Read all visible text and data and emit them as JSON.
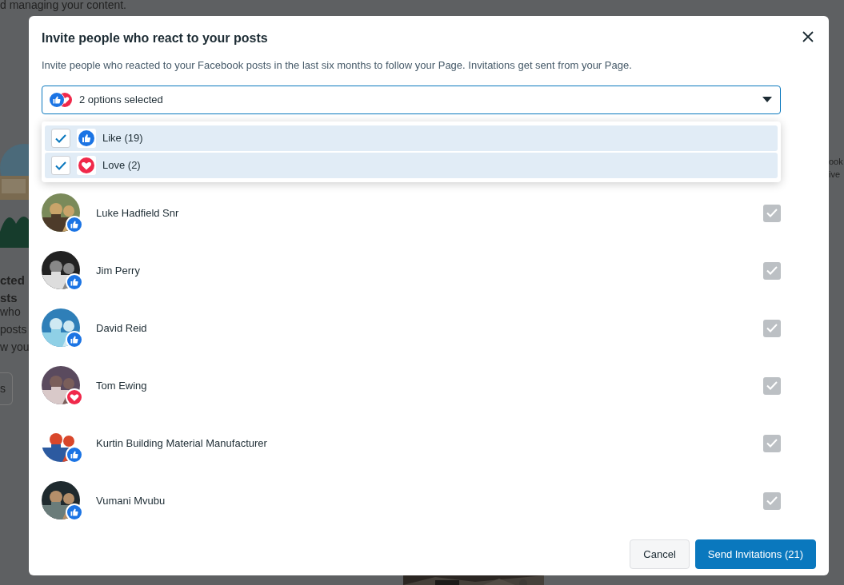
{
  "background": {
    "fragments": [
      {
        "kind": "line",
        "text": "d managing your content."
      },
      {
        "kind": "heading",
        "text": "cted"
      },
      {
        "kind": "heading",
        "text": "sts"
      },
      {
        "kind": "line",
        "text": "who"
      },
      {
        "kind": "line",
        "text": "posts"
      },
      {
        "kind": "line",
        "text": "w you"
      },
      {
        "kind": "button",
        "text": "s"
      },
      {
        "kind": "side",
        "text": "ook"
      },
      {
        "kind": "side",
        "text": "ive"
      }
    ]
  },
  "dialog": {
    "title": "Invite people who react to your posts",
    "description": "Invite people who reacted to your Facebook posts in the last six months to follow your Page. Invitations get sent from your Page.",
    "filter": {
      "value": "2 options selected",
      "expanded": true,
      "options": [
        {
          "kind": "like",
          "label": "Like (19)",
          "checked": true
        },
        {
          "kind": "love",
          "label": "Love (2)",
          "checked": true
        }
      ]
    },
    "people": [
      {
        "name": "Luke Hadfield Snr",
        "kind": "like",
        "checked": true,
        "disabled": true
      },
      {
        "name": "Jim Perry",
        "kind": "like",
        "checked": true,
        "disabled": true
      },
      {
        "name": "David Reid",
        "kind": "like",
        "checked": true,
        "disabled": true
      },
      {
        "name": "Tom Ewing",
        "kind": "love",
        "checked": true,
        "disabled": true
      },
      {
        "name": "Kurtin Building Material Manufacturer",
        "kind": "like",
        "checked": true,
        "disabled": true
      },
      {
        "name": "Vumani Mvubu",
        "kind": "like",
        "checked": true,
        "disabled": true
      }
    ],
    "buttons": [
      {
        "kind": "secondary",
        "label": "Cancel"
      },
      {
        "kind": "primary",
        "label": "Send Invitations (21)"
      }
    ]
  }
}
